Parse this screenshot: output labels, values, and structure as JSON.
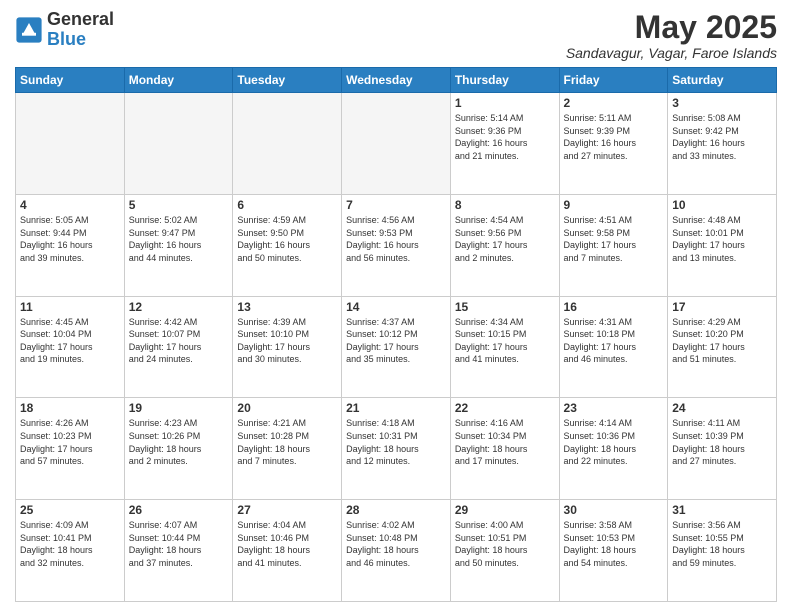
{
  "logo": {
    "general": "General",
    "blue": "Blue"
  },
  "header": {
    "month": "May 2025",
    "location": "Sandavagur, Vagar, Faroe Islands"
  },
  "weekdays": [
    "Sunday",
    "Monday",
    "Tuesday",
    "Wednesday",
    "Thursday",
    "Friday",
    "Saturday"
  ],
  "weeks": [
    [
      {
        "day": "",
        "info": ""
      },
      {
        "day": "",
        "info": ""
      },
      {
        "day": "",
        "info": ""
      },
      {
        "day": "",
        "info": ""
      },
      {
        "day": "1",
        "info": "Sunrise: 5:14 AM\nSunset: 9:36 PM\nDaylight: 16 hours\nand 21 minutes."
      },
      {
        "day": "2",
        "info": "Sunrise: 5:11 AM\nSunset: 9:39 PM\nDaylight: 16 hours\nand 27 minutes."
      },
      {
        "day": "3",
        "info": "Sunrise: 5:08 AM\nSunset: 9:42 PM\nDaylight: 16 hours\nand 33 minutes."
      }
    ],
    [
      {
        "day": "4",
        "info": "Sunrise: 5:05 AM\nSunset: 9:44 PM\nDaylight: 16 hours\nand 39 minutes."
      },
      {
        "day": "5",
        "info": "Sunrise: 5:02 AM\nSunset: 9:47 PM\nDaylight: 16 hours\nand 44 minutes."
      },
      {
        "day": "6",
        "info": "Sunrise: 4:59 AM\nSunset: 9:50 PM\nDaylight: 16 hours\nand 50 minutes."
      },
      {
        "day": "7",
        "info": "Sunrise: 4:56 AM\nSunset: 9:53 PM\nDaylight: 16 hours\nand 56 minutes."
      },
      {
        "day": "8",
        "info": "Sunrise: 4:54 AM\nSunset: 9:56 PM\nDaylight: 17 hours\nand 2 minutes."
      },
      {
        "day": "9",
        "info": "Sunrise: 4:51 AM\nSunset: 9:58 PM\nDaylight: 17 hours\nand 7 minutes."
      },
      {
        "day": "10",
        "info": "Sunrise: 4:48 AM\nSunset: 10:01 PM\nDaylight: 17 hours\nand 13 minutes."
      }
    ],
    [
      {
        "day": "11",
        "info": "Sunrise: 4:45 AM\nSunset: 10:04 PM\nDaylight: 17 hours\nand 19 minutes."
      },
      {
        "day": "12",
        "info": "Sunrise: 4:42 AM\nSunset: 10:07 PM\nDaylight: 17 hours\nand 24 minutes."
      },
      {
        "day": "13",
        "info": "Sunrise: 4:39 AM\nSunset: 10:10 PM\nDaylight: 17 hours\nand 30 minutes."
      },
      {
        "day": "14",
        "info": "Sunrise: 4:37 AM\nSunset: 10:12 PM\nDaylight: 17 hours\nand 35 minutes."
      },
      {
        "day": "15",
        "info": "Sunrise: 4:34 AM\nSunset: 10:15 PM\nDaylight: 17 hours\nand 41 minutes."
      },
      {
        "day": "16",
        "info": "Sunrise: 4:31 AM\nSunset: 10:18 PM\nDaylight: 17 hours\nand 46 minutes."
      },
      {
        "day": "17",
        "info": "Sunrise: 4:29 AM\nSunset: 10:20 PM\nDaylight: 17 hours\nand 51 minutes."
      }
    ],
    [
      {
        "day": "18",
        "info": "Sunrise: 4:26 AM\nSunset: 10:23 PM\nDaylight: 17 hours\nand 57 minutes."
      },
      {
        "day": "19",
        "info": "Sunrise: 4:23 AM\nSunset: 10:26 PM\nDaylight: 18 hours\nand 2 minutes."
      },
      {
        "day": "20",
        "info": "Sunrise: 4:21 AM\nSunset: 10:28 PM\nDaylight: 18 hours\nand 7 minutes."
      },
      {
        "day": "21",
        "info": "Sunrise: 4:18 AM\nSunset: 10:31 PM\nDaylight: 18 hours\nand 12 minutes."
      },
      {
        "day": "22",
        "info": "Sunrise: 4:16 AM\nSunset: 10:34 PM\nDaylight: 18 hours\nand 17 minutes."
      },
      {
        "day": "23",
        "info": "Sunrise: 4:14 AM\nSunset: 10:36 PM\nDaylight: 18 hours\nand 22 minutes."
      },
      {
        "day": "24",
        "info": "Sunrise: 4:11 AM\nSunset: 10:39 PM\nDaylight: 18 hours\nand 27 minutes."
      }
    ],
    [
      {
        "day": "25",
        "info": "Sunrise: 4:09 AM\nSunset: 10:41 PM\nDaylight: 18 hours\nand 32 minutes."
      },
      {
        "day": "26",
        "info": "Sunrise: 4:07 AM\nSunset: 10:44 PM\nDaylight: 18 hours\nand 37 minutes."
      },
      {
        "day": "27",
        "info": "Sunrise: 4:04 AM\nSunset: 10:46 PM\nDaylight: 18 hours\nand 41 minutes."
      },
      {
        "day": "28",
        "info": "Sunrise: 4:02 AM\nSunset: 10:48 PM\nDaylight: 18 hours\nand 46 minutes."
      },
      {
        "day": "29",
        "info": "Sunrise: 4:00 AM\nSunset: 10:51 PM\nDaylight: 18 hours\nand 50 minutes."
      },
      {
        "day": "30",
        "info": "Sunrise: 3:58 AM\nSunset: 10:53 PM\nDaylight: 18 hours\nand 54 minutes."
      },
      {
        "day": "31",
        "info": "Sunrise: 3:56 AM\nSunset: 10:55 PM\nDaylight: 18 hours\nand 59 minutes."
      }
    ]
  ]
}
